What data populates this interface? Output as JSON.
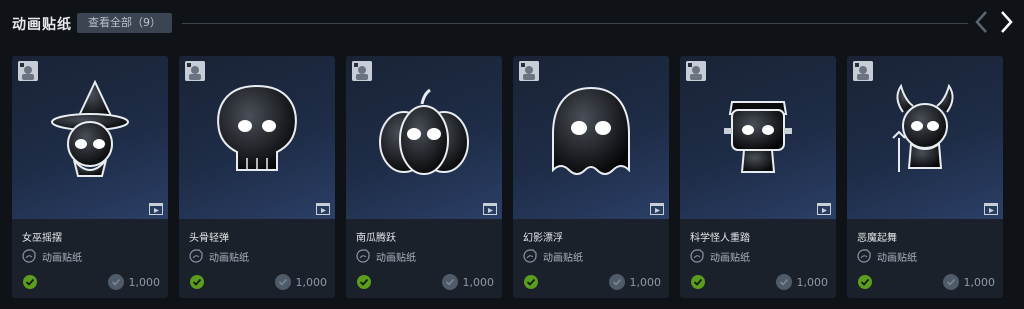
{
  "header": {
    "title": "动画贴纸",
    "view_all_label": "查看全部（9）"
  },
  "card_type_label": "动画贴纸",
  "cards": [
    {
      "name": "女巫摇摆",
      "price": "1,000",
      "icon": "witch"
    },
    {
      "name": "头骨轻弹",
      "price": "1,000",
      "icon": "skull"
    },
    {
      "name": "南瓜腾跃",
      "price": "1,000",
      "icon": "pumpkin"
    },
    {
      "name": "幻影漂浮",
      "price": "1,000",
      "icon": "ghost"
    },
    {
      "name": "科学怪人重踏",
      "price": "1,000",
      "icon": "frankenstein"
    },
    {
      "name": "恶魔起舞",
      "price": "1,000",
      "icon": "devil"
    }
  ],
  "colors": {
    "background": "#0f1318",
    "card": "#1b212a",
    "owned_check": "#5c9c1f",
    "coin": "#4f5b69"
  }
}
